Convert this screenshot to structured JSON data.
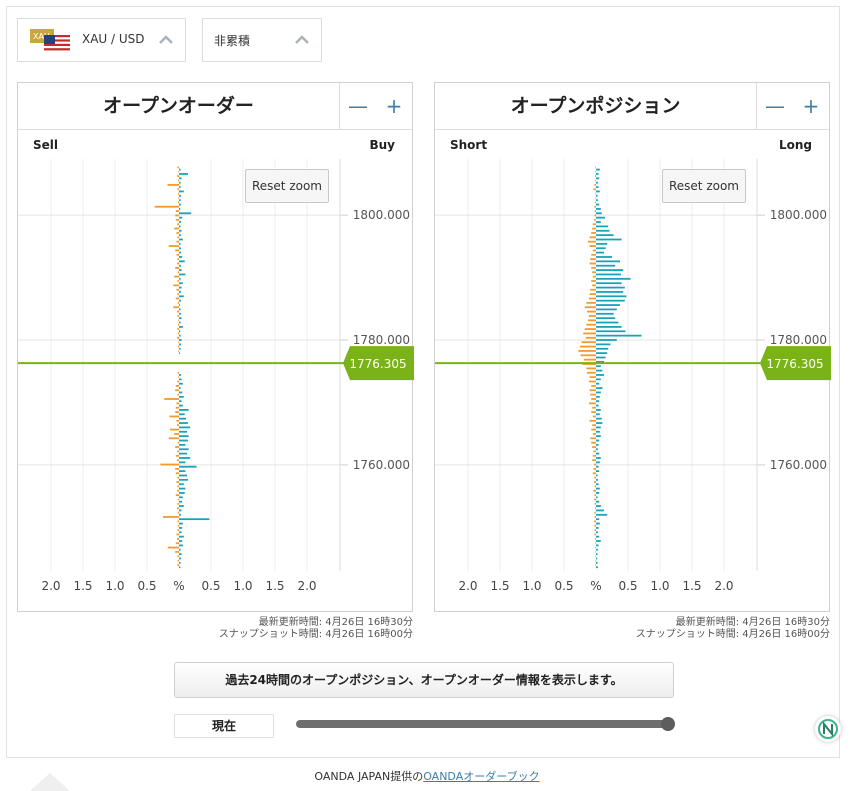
{
  "instrument": {
    "label": "XAU / USD",
    "flag_text": "XAU"
  },
  "mode": {
    "label": "非累積"
  },
  "colors": {
    "sell": "#f39a2a",
    "buy": "#1aa3b8",
    "price_line": "#7ab317",
    "price_tag": "#7ab317",
    "accent": "#3b7fa8"
  },
  "panels": [
    {
      "title": "オープンオーダー",
      "left_label": "Sell",
      "right_label": "Buy",
      "reset_label": "Reset zoom",
      "minus": "—",
      "plus": "+",
      "updated": "最新更新時間: 4月26日 16時30分",
      "snapshot": "スナップショット時間: 4月26日 16時00分"
    },
    {
      "title": "オープンポジション",
      "left_label": "Short",
      "right_label": "Long",
      "reset_label": "Reset zoom",
      "minus": "—",
      "plus": "+",
      "updated": "最新更新時間: 4月26日 16時30分",
      "snapshot": "スナップショット時間: 4月26日 16時00分"
    }
  ],
  "chart_data": [
    {
      "type": "bar",
      "orientation": "horizontal",
      "title": "オープンオーダー",
      "price_ticks": [
        "1800.000",
        "1780.000",
        "1760.000"
      ],
      "price_tick_values": [
        1800,
        1780,
        1760
      ],
      "current_price": "1776.305",
      "current_price_value": 1776.305,
      "x_tick_labels": [
        "2.0",
        "1.5",
        "1.0",
        "0.5",
        "%",
        "0.5",
        "1.0",
        "1.5",
        "2.0"
      ],
      "xlim_pct": [
        -2.0,
        2.0
      ],
      "ylim": [
        1743,
        1809
      ],
      "price_step": 0.5,
      "series": [
        {
          "name": "Sell",
          "values": [
            0.05,
            0.02,
            0.06,
            0.03,
            0.36,
            0.05,
            0.03,
            0.02,
            0.03,
            0.76,
            0.1,
            0.12,
            0.1,
            0.06,
            0.15,
            0.08,
            0.05,
            0.08,
            0.32,
            0.12,
            0.08,
            0.05,
            0.06,
            0.12,
            0.04,
            0.15,
            0.05,
            0.18,
            0.08,
            0.05,
            0.1,
            0.04,
            0.18,
            0.06,
            0.05,
            0.02,
            0.03,
            0.05,
            0.03,
            0.06,
            0.02,
            0.03,
            0.02,
            0.0,
            0.0,
            0.0,
            0.0,
            0.04,
            0.02,
            0.05,
            0.1,
            0.12,
            0.05,
            0.46,
            0.08,
            0.1,
            0.12,
            0.3,
            0.08,
            0.06,
            0.28,
            0.15,
            0.32,
            0.04,
            0.12,
            0.05,
            0.1,
            0.06,
            0.58,
            0.12,
            0.1,
            0.05,
            0.08,
            0.05,
            0.06,
            0.1,
            0.04,
            0.05,
            0.06,
            0.04,
            0.5,
            0.05,
            0.04,
            0.05,
            0.08,
            0.06,
            0.1,
            0.35,
            0.12,
            0.05,
            0.04,
            0.05
          ]
        },
        {
          "name": "Buy",
          "values": [
            0.05,
            0.28,
            0.08,
            0.05,
            0.05,
            0.15,
            0.06,
            0.05,
            0.06,
            0.04,
            0.38,
            0.1,
            0.06,
            0.05,
            0.08,
            0.06,
            0.12,
            0.05,
            0.06,
            0.06,
            0.1,
            0.18,
            0.06,
            0.08,
            0.2,
            0.05,
            0.12,
            0.08,
            0.06,
            0.15,
            0.06,
            0.03,
            0.05,
            0.06,
            0.08,
            0.05,
            0.12,
            0.04,
            0.05,
            0.08,
            0.06,
            0.05,
            0.03,
            0.0,
            0.0,
            0.0,
            0.0,
            0.06,
            0.08,
            0.12,
            0.05,
            0.1,
            0.15,
            0.08,
            0.12,
            0.3,
            0.18,
            0.22,
            0.28,
            0.35,
            0.25,
            0.3,
            0.28,
            0.2,
            0.3,
            0.25,
            0.35,
            0.2,
            0.55,
            0.2,
            0.25,
            0.28,
            0.15,
            0.2,
            0.18,
            0.12,
            0.1,
            0.15,
            0.08,
            0.06,
            0.95,
            0.12,
            0.1,
            0.08,
            0.15,
            0.1,
            0.12,
            0.05,
            0.08,
            0.06,
            0.05,
            0.04
          ]
        }
      ]
    },
    {
      "type": "bar",
      "orientation": "horizontal",
      "title": "オープンポジション",
      "price_ticks": [
        "1800.000",
        "1780.000",
        "1760.000"
      ],
      "price_tick_values": [
        1800,
        1780,
        1760
      ],
      "current_price": "1776.305",
      "current_price_value": 1776.305,
      "x_tick_labels": [
        "2.0",
        "1.5",
        "1.0",
        "0.5",
        "%",
        "0.5",
        "1.0",
        "1.5",
        "2.0"
      ],
      "xlim_pct": [
        -2.0,
        2.0
      ],
      "ylim": [
        1743,
        1809
      ],
      "price_step": 0.5,
      "series": [
        {
          "name": "Short",
          "values": [
            0.02,
            0.02,
            0.03,
            0.02,
            0.05,
            0.08,
            0.02,
            0.02,
            0.03,
            0.05,
            0.04,
            0.05,
            0.06,
            0.1,
            0.12,
            0.15,
            0.2,
            0.25,
            0.2,
            0.1,
            0.15,
            0.18,
            0.2,
            0.15,
            0.12,
            0.1,
            0.15,
            0.12,
            0.18,
            0.2,
            0.22,
            0.3,
            0.35,
            0.28,
            0.22,
            0.25,
            0.3,
            0.35,
            0.4,
            0.32,
            0.45,
            0.5,
            0.55,
            0.48,
            0.38,
            0.42,
            0.3,
            0.28,
            0.2,
            0.22,
            0.15,
            0.2,
            0.18,
            0.15,
            0.22,
            0.12,
            0.15,
            0.1,
            0.2,
            0.12,
            0.15,
            0.1,
            0.18,
            0.15,
            0.12,
            0.08,
            0.1,
            0.12,
            0.06,
            0.08,
            0.1,
            0.05,
            0.06,
            0.04,
            0.08,
            0.05,
            0.06,
            0.04,
            0.03,
            0.05,
            0.04,
            0.06,
            0.05,
            0.04,
            0.05,
            0.03,
            0.02,
            0.02,
            0.02,
            0.02,
            0.02,
            0.02
          ]
        },
        {
          "name": "Long",
          "values": [
            0.12,
            0.08,
            0.1,
            0.06,
            0.08,
            0.12,
            0.05,
            0.06,
            0.1,
            0.15,
            0.18,
            0.28,
            0.15,
            0.38,
            0.42,
            0.55,
            0.8,
            0.35,
            0.3,
            0.25,
            0.5,
            0.75,
            0.6,
            0.85,
            0.78,
            1.08,
            0.8,
            0.9,
            0.85,
            0.95,
            0.9,
            0.75,
            0.65,
            0.55,
            0.6,
            0.7,
            0.8,
            0.92,
            1.42,
            0.65,
            0.45,
            0.38,
            0.35,
            0.3,
            0.25,
            0.15,
            0.2,
            0.25,
            0.15,
            0.1,
            0.2,
            0.15,
            0.12,
            0.1,
            0.08,
            0.15,
            0.12,
            0.18,
            0.2,
            0.15,
            0.12,
            0.15,
            0.1,
            0.08,
            0.06,
            0.1,
            0.15,
            0.12,
            0.08,
            0.1,
            0.05,
            0.06,
            0.08,
            0.12,
            0.1,
            0.05,
            0.1,
            0.15,
            0.25,
            0.35,
            0.1,
            0.12,
            0.08,
            0.06,
            0.1,
            0.15,
            0.08,
            0.06,
            0.05,
            0.04,
            0.05,
            0.06
          ]
        }
      ]
    }
  ],
  "history_button": "過去24時間のオープンポジション、オープンオーダー情報を表示します。",
  "now_label": "現在",
  "slider": {
    "value": 1.0
  },
  "footer": {
    "prefix": "OANDA JAPAN提供の",
    "link": "OANDAオーダーブック"
  }
}
